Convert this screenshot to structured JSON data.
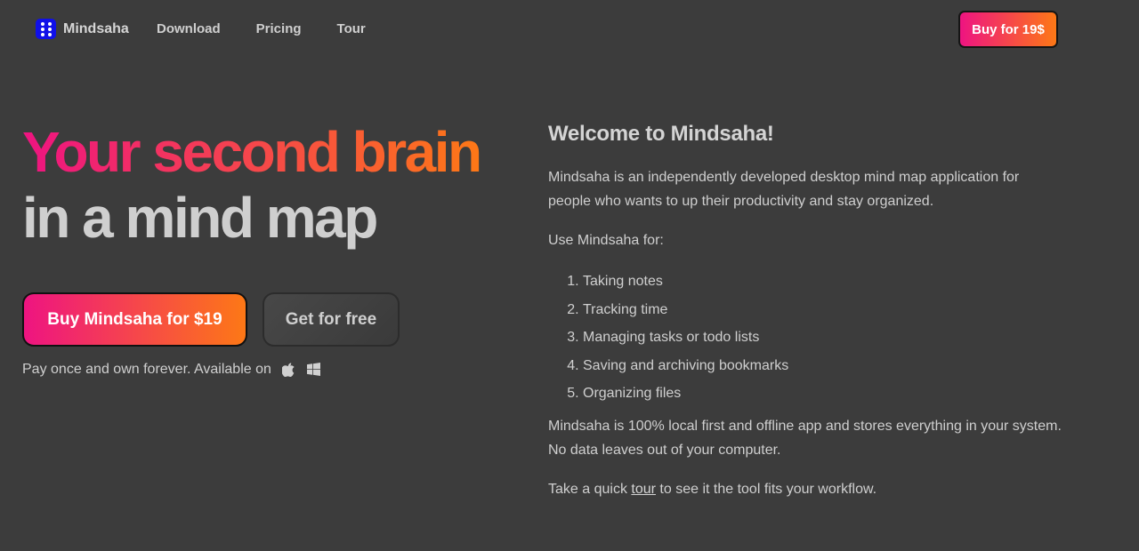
{
  "nav": {
    "logo_text": "Mindsaha",
    "links": [
      "Download",
      "Pricing",
      "Tour"
    ],
    "cta_label": "Buy for 19$"
  },
  "hero": {
    "title_line1": "Your second brain",
    "title_line2": "in a mind map",
    "buy_label": "Buy Mindsaha for $19",
    "free_label": "Get for free",
    "availability_text": "Pay once and own forever. Available on",
    "platform_icons": [
      "apple-icon",
      "windows-icon"
    ]
  },
  "about": {
    "heading": "Welcome to Mindsaha!",
    "intro": "Mindsaha is an independently developed desktop mind map application for people who wants to up their productivity and stay organized.",
    "use_label": "Use Mindsaha for:",
    "uses": [
      "Taking notes",
      "Tracking time",
      "Managing tasks or todo lists",
      "Saving and archiving bookmarks",
      "Organizing files"
    ],
    "local_text": "Mindsaha is 100% local first and offline app and stores everything in your system. No data leaves out of your computer.",
    "tour_prefix": "Take a quick",
    "tour_link": "tour",
    "tour_suffix": "to see it the tool fits your workflow."
  },
  "colors": {
    "background": "#3c3c3c",
    "gradient_start": "#ee1481",
    "gradient_end": "#fd7816",
    "logo_blue": "#1010e8",
    "text": "#cfcfcf"
  }
}
